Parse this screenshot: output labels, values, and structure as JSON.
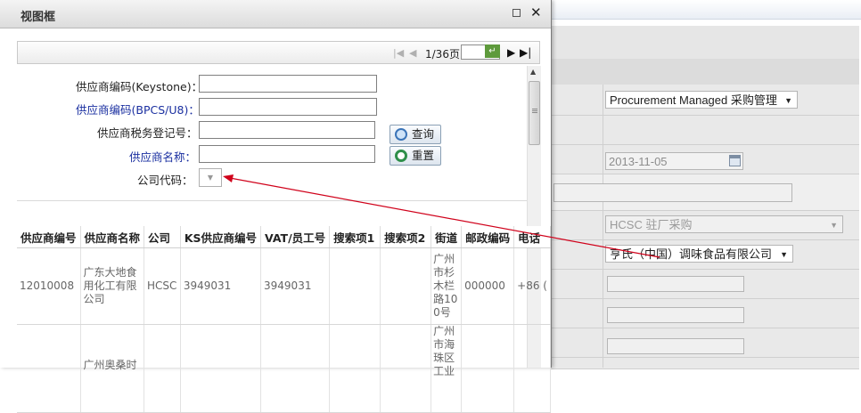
{
  "dialog": {
    "title": "视图框"
  },
  "pager": {
    "page_info": "1/36页"
  },
  "search_form": {
    "keystone_label": "供应商编码(Keystone)：",
    "bpcs_label": "供应商编码(BPCS/U8)：",
    "tax_label": "供应商税务登记号：",
    "name_label": "供应商名称：",
    "company_label": "公司代码：",
    "query_button": "查询",
    "reset_button": "重置"
  },
  "table": {
    "headers": [
      "供应商编号",
      "供应商名称",
      "公司",
      "KS供应商编号",
      "VAT/员工号",
      "搜索项1",
      "搜索项2",
      "街道",
      "邮政编码",
      "电话"
    ],
    "rows": [
      [
        "12010008",
        "广东大地食用化工有限公司",
        "HCSC",
        "3949031",
        "3949031",
        "",
        "",
        "广州市杉木栏路100号",
        "000000",
        "+86 ("
      ],
      [
        "",
        "广州奥桑时",
        "",
        "",
        "",
        "",
        "",
        "广州市海珠区工业",
        "",
        ""
      ]
    ]
  },
  "background": {
    "procurement_select": "Procurement Managed 采购管理",
    "date_value": "2013-11-05",
    "hcsc_select": "HCSC 驻厂采购",
    "company_select": "亨氏（中国）调味食品有限公司"
  },
  "colors": {
    "arrow": "#d0021b",
    "blue_label": "#1a2fa0",
    "go_button": "#5e9a3c"
  }
}
